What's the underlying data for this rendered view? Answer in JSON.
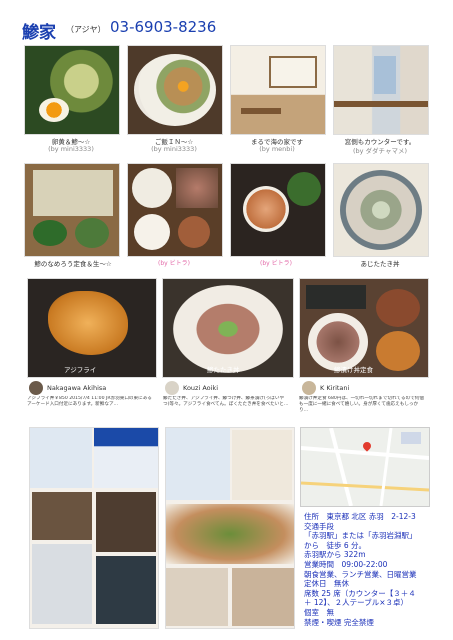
{
  "header": {
    "title": "鯵家",
    "reading": "（アジヤ）",
    "phone": "03-6903-8236"
  },
  "row1": [
    {
      "caption": "卵黄＆鯵〜☆",
      "credit": "(by mini3333)"
    },
    {
      "caption": "ご飯ＩＮ〜☆",
      "credit": "(by mini3333)"
    },
    {
      "caption": "まるで海の家です",
      "credit": "(by menbi)"
    },
    {
      "caption": "窓側もカウンターです。",
      "credit": "(by ダダチャマメ)"
    }
  ],
  "row2": [
    {
      "caption": "鯵のなめろう定食＆生〜☆",
      "credit": ""
    },
    {
      "caption": "",
      "credit": "(by ビトラ)"
    },
    {
      "caption": "",
      "credit": "(by ビトラ)"
    },
    {
      "caption": "あじたたき丼",
      "credit": ""
    }
  ],
  "row3": [
    {
      "tag": "アジフライ"
    },
    {
      "tag": "鯵たたき丼"
    },
    {
      "tag": "鯵漬け丼定食"
    }
  ],
  "reviews": [
    {
      "name": "Nakagawa Akihisa",
      "text": "アジフライ丼￥850 2015/7/4 11:00 JR赤羽東口の東にあるアーケード入口付近にあります。新鮮なア…"
    },
    {
      "name": "Kouzi Aoiki",
      "text": "鯵たたき丼、アジフライ丼、鯵づけ丼、鯵茶漬け(っぽいやつ)等々。アジフライ食べてん。ぼくたたき丼を食べたいと…"
    },
    {
      "name": "K Kiritani",
      "text": "鯵漬け丼定食 680円は、一切れ一切れまで切れてるので何個も一度に一緒に食べて嬉しい。身が厚くて歯応えもしっかり…"
    }
  ],
  "info": {
    "address": "住所　東京都 北区 赤羽　2-12-3",
    "transport_label": "交通手段",
    "transport_1": "「赤羽駅」または「赤羽岩淵駅」",
    "transport_2": "から　徒歩 6 分。",
    "transport_3": "赤羽駅から 322m",
    "hours": "営業時間　09:00-22:00",
    "hours_note": "朝食営業、ランチ営業、日曜営業",
    "closed": "定休日　無休",
    "seats_1": "席数 25 席（カウンター【３＋４",
    "seats_2": "＋ 12】、２人テーブル×３卓）",
    "private_room": "個室　無",
    "smoking": "禁煙・喫煙 完全禁煙"
  },
  "colors": {
    "accent": "#1a3fb0",
    "credit": "#e36aa8"
  }
}
